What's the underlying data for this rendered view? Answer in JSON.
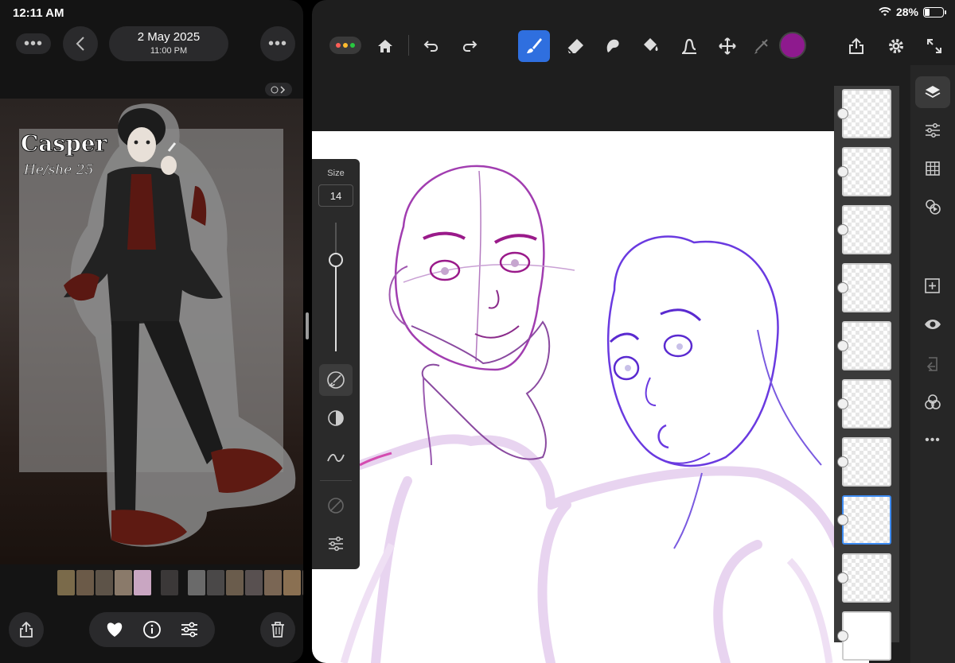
{
  "status_bar": {
    "time": "12:11 AM",
    "battery": "28%",
    "battery_level": 0.28
  },
  "photos": {
    "date": "2 May 2025",
    "time": "11:00 PM",
    "image_title": "Casper",
    "image_subtitle": "He/she 25",
    "icons": {
      "more_left": "ellipsis-icon",
      "back": "chevron-left-icon",
      "more_right": "ellipsis-icon",
      "live": "live-photo-icon",
      "share": "share-icon",
      "favorite": "heart-icon",
      "info": "info-icon",
      "adjust": "sliders-icon",
      "delete": "trash-icon"
    },
    "thumbnail_colors": [
      "#7a6a4a",
      "#6b5a48",
      "#5d5348",
      "#8a7a6a",
      "#c9a6c2",
      "#3b3838",
      "#6a6a6a",
      "#4a4848",
      "#6a5c4c",
      "#585050",
      "#7a6654",
      "#8a7052",
      "#665a52"
    ]
  },
  "fresco": {
    "brush_size_label": "Size",
    "brush_size_value": "14",
    "brush_slider_level": 0.71,
    "current_color": "#8e1a8e",
    "toolbar": {
      "home": "home-icon",
      "undo": "undo-icon",
      "redo": "redo-icon",
      "brush": "paint-brush-icon",
      "eraser": "eraser-icon",
      "smudge": "smudge-icon",
      "fill": "paint-bucket-icon",
      "liquify": "liquify-icon",
      "transform": "move-icon",
      "selection": "lasso-icon",
      "share": "share-icon",
      "settings": "gear-icon",
      "fullscreen": "expand-icon"
    },
    "layer_count": 10,
    "selected_layer": 8
  }
}
